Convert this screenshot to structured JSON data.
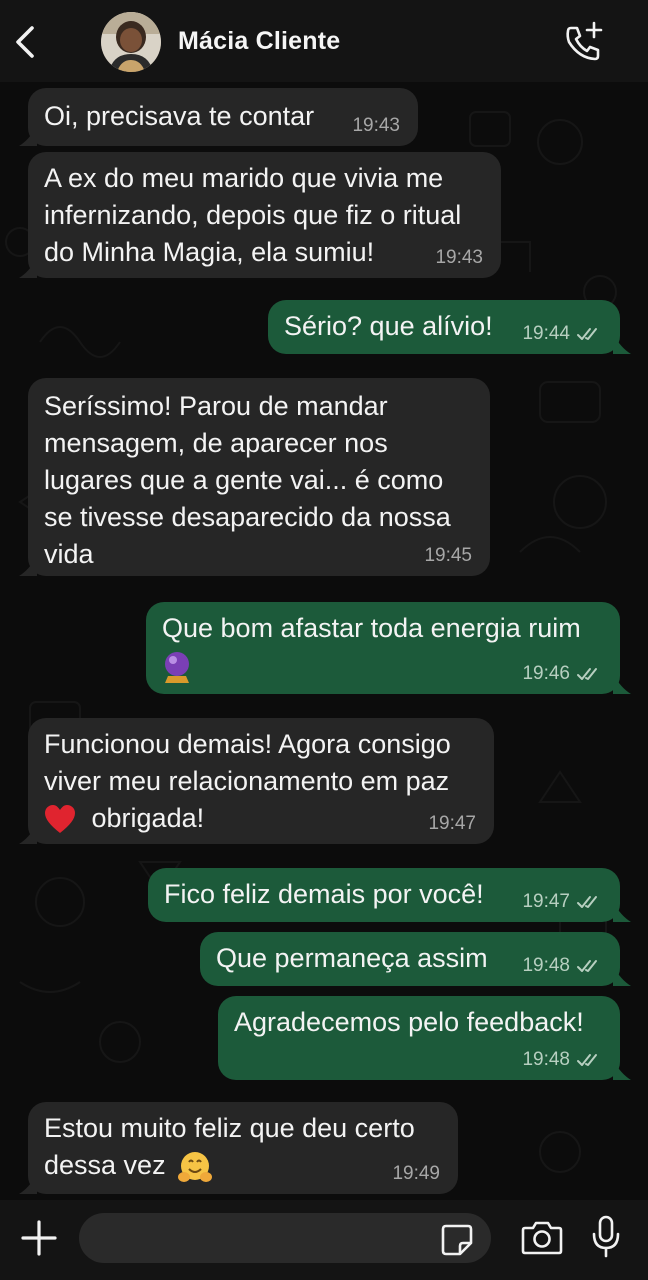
{
  "header": {
    "contact_name": "Mácia Cliente",
    "icons": {
      "back": "chevron-left-icon",
      "call": "phone-add-icon"
    }
  },
  "messages": [
    {
      "direction": "incoming",
      "text": "Oi, precisava te contar",
      "time": "19:43"
    },
    {
      "direction": "incoming",
      "text": "A ex do meu marido que vivia me\ninfernizando, depois que fiz o ritual\ndo Minha Magia, ela sumiu!",
      "time": "19:43"
    },
    {
      "direction": "outgoing",
      "text": "Sério? que alívio!",
      "time": "19:44",
      "status": "read"
    },
    {
      "direction": "incoming",
      "text": "Seríssimo! Parou de mandar\nmensagem, de aparecer nos\nlugares que a gente vai... é como\nse tivesse desaparecido da nossa\nvida",
      "time": "19:45"
    },
    {
      "direction": "outgoing",
      "text": "Que bom afastar toda energia ruim",
      "emoji": "crystal-ball",
      "time": "19:46",
      "status": "read"
    },
    {
      "direction": "incoming",
      "text_line1": "Funcionou demais! Agora consigo",
      "text_line2": "viver meu relacionamento em paz",
      "text_line3": "obrigada!",
      "emoji": "red-heart",
      "time": "19:47"
    },
    {
      "direction": "outgoing",
      "text": "Fico feliz demais por você!",
      "time": "19:47",
      "status": "read"
    },
    {
      "direction": "outgoing",
      "text": "Que permaneça assim",
      "time": "19:48",
      "status": "read"
    },
    {
      "direction": "outgoing",
      "text": "Agradecemos pelo feedback!",
      "time": "19:48",
      "status": "read"
    },
    {
      "direction": "incoming",
      "text_line1": "Estou muito feliz que deu certo",
      "text_line2": "dessa vez",
      "emoji": "hugging-face",
      "time": "19:49"
    }
  ],
  "composer": {
    "placeholder": "",
    "icons": {
      "attach": "plus-icon",
      "sticker": "sticker-icon",
      "camera": "camera-icon",
      "mic": "microphone-icon"
    }
  },
  "colors": {
    "incoming_bubble": "#262626",
    "outgoing_bubble": "#1c5a3a",
    "background": "#0c0c0c",
    "bars": "#141414"
  }
}
